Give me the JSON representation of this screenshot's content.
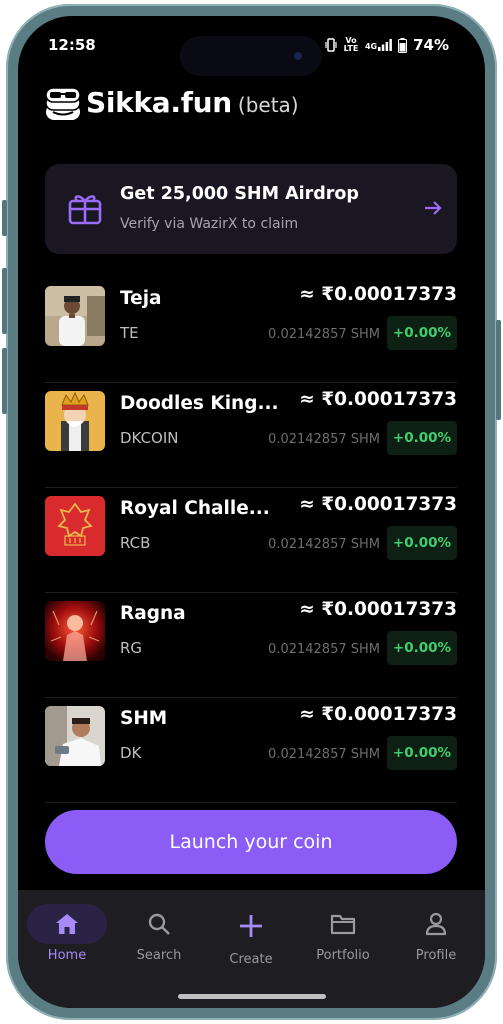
{
  "status": {
    "time": "12:58",
    "volte": "Vo LTE",
    "network": "4G",
    "battery": "74%"
  },
  "app": {
    "name": "Sikka.fun",
    "tag": "(beta)"
  },
  "airdrop": {
    "title": "Get 25,000 SHM Airdrop",
    "subtitle": "Verify via WazirX to claim"
  },
  "coins": [
    {
      "name": "Teja",
      "symbol": "TE",
      "price": "≈ ₹0.00017373",
      "shm": "0.02142857 SHM",
      "change": "+0.00%"
    },
    {
      "name": "Doodles King...",
      "symbol": "DKCOIN",
      "price": "≈ ₹0.00017373",
      "shm": "0.02142857 SHM",
      "change": "+0.00%"
    },
    {
      "name": "Royal Challe...",
      "symbol": "RCB",
      "price": "≈ ₹0.00017373",
      "shm": "0.02142857 SHM",
      "change": "+0.00%"
    },
    {
      "name": "Ragna",
      "symbol": "RG",
      "price": "≈ ₹0.00017373",
      "shm": "0.02142857 SHM",
      "change": "+0.00%"
    },
    {
      "name": "SHM",
      "symbol": "DK",
      "price": "≈ ₹0.00017373",
      "shm": "0.02142857 SHM",
      "change": "+0.00%"
    }
  ],
  "launch_label": "Launch your coin",
  "nav": [
    {
      "label": "Home",
      "icon": "home-icon",
      "active": true
    },
    {
      "label": "Search",
      "icon": "search-icon",
      "active": false
    },
    {
      "label": "Create",
      "icon": "plus-icon",
      "active": false
    },
    {
      "label": "Portfolio",
      "icon": "folder-icon",
      "active": false
    },
    {
      "label": "Profile",
      "icon": "user-icon",
      "active": false
    }
  ],
  "colors": {
    "accent": "#8b5cf6",
    "background": "#000000",
    "positive": "#3fcf6f",
    "card": "#1a1723",
    "navbar": "#1d1d22"
  }
}
